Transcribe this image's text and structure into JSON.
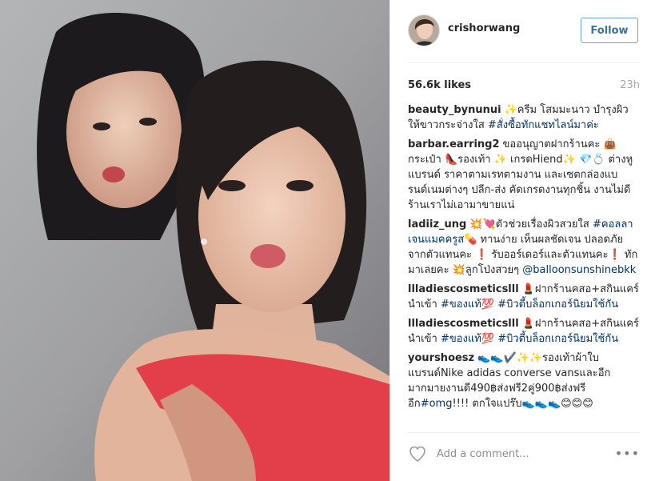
{
  "post": {
    "username": "crishorwang",
    "follow_label": "Follow",
    "likes": "56.6k likes",
    "time": "23h"
  },
  "comments": [
    {
      "user": "beauty_bynunui",
      "text": "✨ครีม โสมมะนาว บำรุงผิวให้ขาวกระจ่างใส",
      "tag": "#สั่งซื้อทักแชทไลน์มาค่ะ"
    },
    {
      "user": "barbar.earring2",
      "text": "ขออนุญาตฝากร้านคะ 👜 กระเป๋า 👠รองเท้า ✨ เกรดHiend✨ 💎💍 ต่างหูแบรนด์ ราคาตามเรทตามงาน และเซตกล่องแบรนด์เนมต่างๆ ปลีก-ส่ง คัดเกรดงานทุกชิ้น งานไม่ดีร้านเราไม่เอามาขายแน่"
    },
    {
      "user": "ladiiz_ung",
      "text": "💥💘ตัวช่วยเรื่องผิวสวยใส",
      "tag": "#คอลลาเจนแมคครูส",
      "text2": "💊 ทานง่าย เห็นผลชัดเจน ปลอดภัย จากตัวแทนคะ ❗ รับออร์เดอร์และตัวแทนคะ❗ ทักมาเลยคะ 💥ลูกโป่งสวยๆ",
      "mention": "@balloonsunshinebkk"
    },
    {
      "user": "llladiescosmeticslll",
      "text": "💄ฝากร้านคสอ+สกินแคร์นำเข้า",
      "tag": "#ของแท้💯",
      "tag2": "#บิวตี้บล็อกเกอร์นิยมใช้กัน"
    },
    {
      "user": "llladiescosmeticslll",
      "text": "💄ฝากร้านคสอ+สกินแคร์นำเข้า",
      "tag": "#ของแท้💯",
      "tag2": "#บิวตี้บล็อกเกอร์นิยมใช้กัน"
    },
    {
      "user": "yourshoesz",
      "text": "👟👟✔️✨✨รองเท้าผ้าใบแบรนด์Nike adidas converse vansและอีกมากมายงานดี490฿ส่งฟรี2คู่900฿ส่งฟรีอีก",
      "tag": "#omg",
      "text2": "!!!! ตกใจแปร๊บ👟👟👟😊😊😊"
    }
  ],
  "comment_box": {
    "placeholder": "Add a comment..."
  },
  "more_label": "•••",
  "colors": {
    "link": "#003569",
    "follow": "#3f729b",
    "muted": "#a5a7aa"
  },
  "icons": {
    "like": "heart-icon",
    "options": "more-options-icon"
  }
}
